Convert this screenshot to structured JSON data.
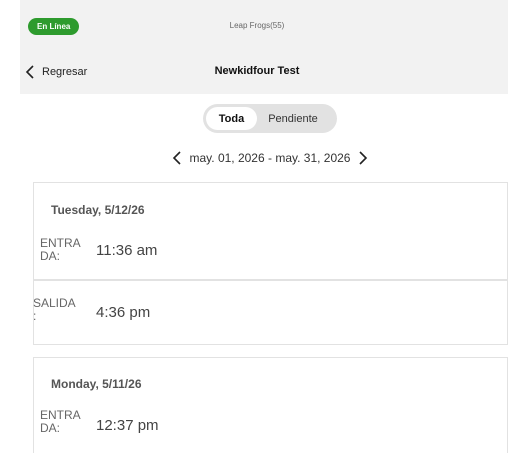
{
  "header": {
    "status_badge": "En Línea",
    "center_name": "Leap Frogs(55)",
    "back_label": "Regresar",
    "child_name": "Newkidfour Test"
  },
  "filter": {
    "tabs": [
      "Toda",
      "Pendiente"
    ],
    "selected": "Toda"
  },
  "date_range": {
    "text": "may. 01, 2026 - may. 31, 2026"
  },
  "days": [
    {
      "date": "Tuesday, 5/12/26",
      "entries": [
        {
          "label_line1": "ENTRA",
          "label_line2": "DA:",
          "time": "11:36 am"
        },
        {
          "label_line1": "SALIDA",
          "label_line2": ":",
          "time": "4:36 pm"
        }
      ]
    },
    {
      "date": "Monday, 5/11/26",
      "entries": [
        {
          "label_line1": "ENTRA",
          "label_line2": "DA:",
          "time": "12:37 pm"
        }
      ]
    }
  ]
}
